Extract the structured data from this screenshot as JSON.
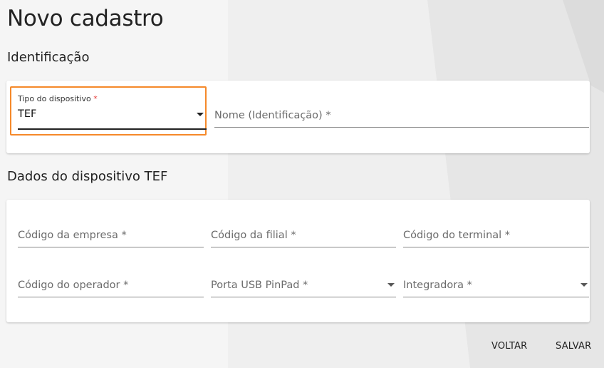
{
  "page": {
    "title": "Novo cadastro"
  },
  "identificacao": {
    "section_title": "Identificação",
    "tipo_dispositivo": {
      "label": "Tipo do dispositivo",
      "required_mark": "*",
      "value": "TEF"
    },
    "nome": {
      "label": "Nome (Identificação) *"
    }
  },
  "dados_dispositivo": {
    "section_title": "Dados do dispositivo TEF",
    "fields": {
      "codigo_empresa": "Código da empresa *",
      "codigo_filial": "Código da filial *",
      "codigo_terminal": "Código do terminal *",
      "codigo_operador": "Código do operador *",
      "porta_usb": "Porta USB PinPad *",
      "integradora": "Integradora *"
    }
  },
  "actions": {
    "voltar": "VOLTAR",
    "salvar": "SALVAR"
  },
  "colors": {
    "highlight": "#f5892a",
    "required": "#e53935",
    "background": "#f5f5f5"
  }
}
